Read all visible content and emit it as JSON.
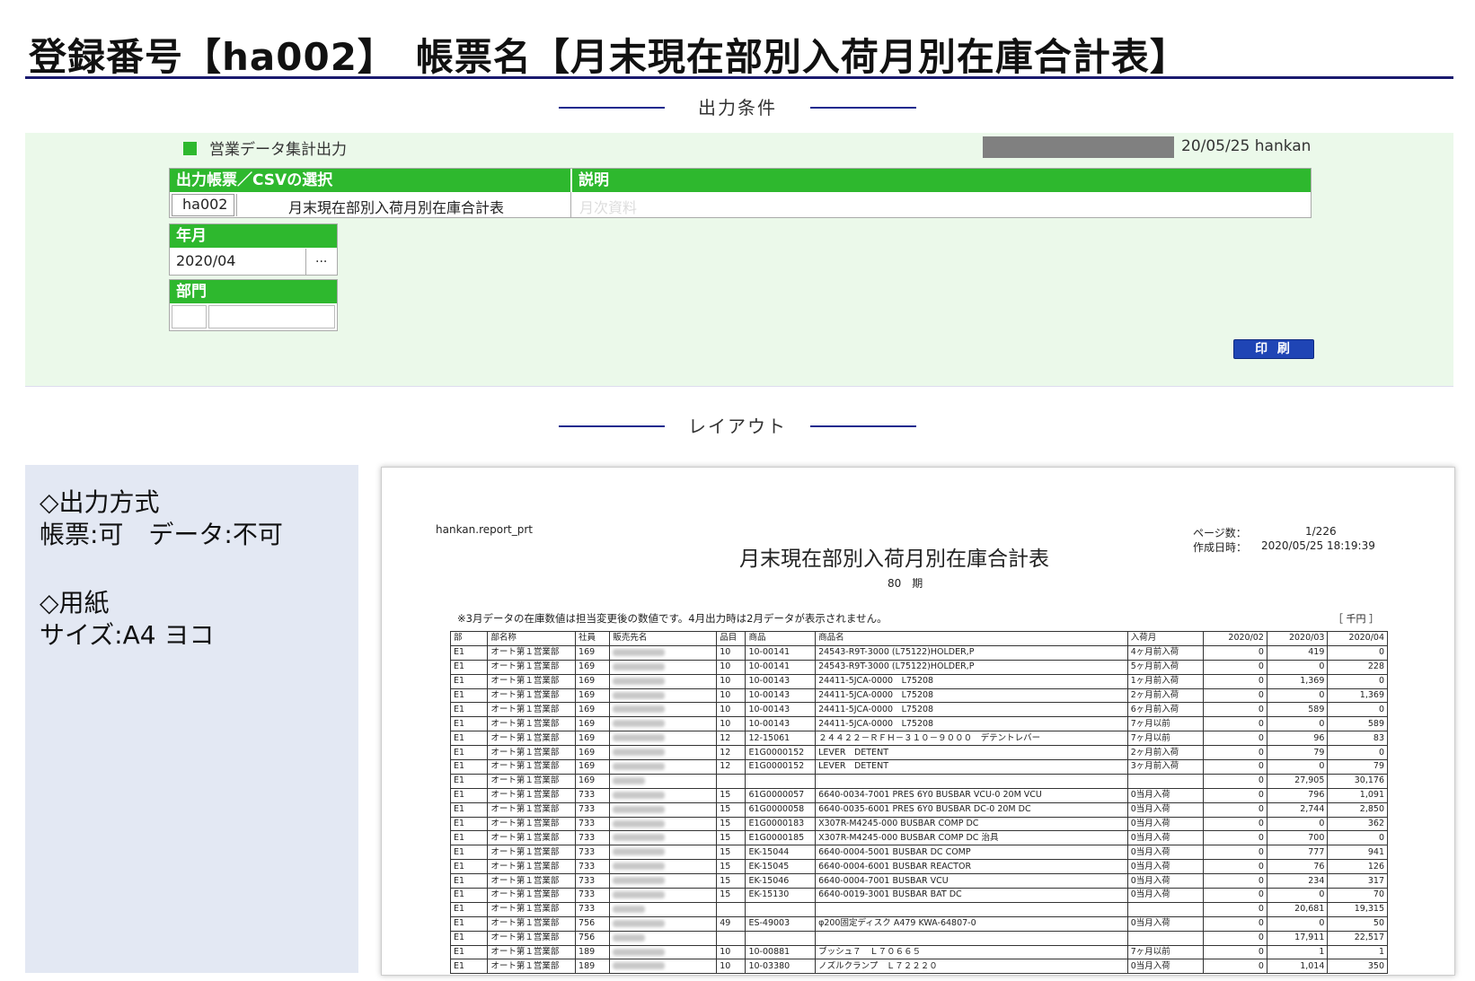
{
  "header": {
    "title": "登録番号【ha002】　帳票名【月末現在部別入荷月別在庫合計表】"
  },
  "sections": {
    "conditions": "出力条件",
    "layout": "レイアウト"
  },
  "condition_panel": {
    "menu_title": "営業データ集計出力",
    "user_info": "20/05/25 hankan",
    "report_select_header": "出力帳票／CSVの選択",
    "description_header": "説明",
    "report_code": "ha002",
    "report_name": "月末現在部別入荷月別在庫合計表",
    "description": "月次資料",
    "year_month_header": "年月",
    "year_month_value": "2020/04",
    "year_month_picker": "...",
    "department_header": "部門",
    "department_code": "",
    "department_name": "",
    "print_button": "印 刷"
  },
  "left_info": {
    "output_method_title": "◇出力方式",
    "output_method_value": "帳票:可　データ:不可",
    "paper_title": "◇用紙",
    "paper_value": "サイズ:A4 ヨコ"
  },
  "report_preview": {
    "program": "hankan.report_prt",
    "page_label": "ページ数：",
    "page_value": "1/226",
    "created_label": "作成日時：",
    "created_value": "2020/05/25 18:19:39",
    "title": "月末現在部別入荷月別在庫合計表",
    "period": "80　期",
    "note": "※3月データの在庫数値は担当変更後の数値です。4月出力時は2月データが表示されません。",
    "unit": "［ 千円 ］",
    "columns": [
      "部",
      "部名称",
      "社員",
      "販売先名",
      "品目",
      "商品",
      "商品名",
      "入荷月",
      "2020/02",
      "2020/03",
      "2020/04"
    ],
    "rows": [
      [
        "E1",
        "オート第１営業部",
        "169",
        "",
        "10",
        "10-00141",
        "24543-R9T-3000 (L75122)HOLDER,P",
        "4ヶ月前入荷",
        "0",
        "419",
        "0"
      ],
      [
        "E1",
        "オート第１営業部",
        "169",
        "",
        "10",
        "10-00141",
        "24543-R9T-3000 (L75122)HOLDER,P",
        "5ヶ月前入荷",
        "0",
        "0",
        "228"
      ],
      [
        "E1",
        "オート第１営業部",
        "169",
        "",
        "10",
        "10-00143",
        "24411-5JCA-0000　L75208",
        "1ヶ月前入荷",
        "0",
        "1,369",
        "0"
      ],
      [
        "E1",
        "オート第１営業部",
        "169",
        "",
        "10",
        "10-00143",
        "24411-5JCA-0000　L75208",
        "2ヶ月前入荷",
        "0",
        "0",
        "1,369"
      ],
      [
        "E1",
        "オート第１営業部",
        "169",
        "",
        "10",
        "10-00143",
        "24411-5JCA-0000　L75208",
        "6ヶ月前入荷",
        "0",
        "589",
        "0"
      ],
      [
        "E1",
        "オート第１営業部",
        "169",
        "",
        "10",
        "10-00143",
        "24411-5JCA-0000　L75208",
        "7ヶ月以前",
        "0",
        "0",
        "589"
      ],
      [
        "E1",
        "オート第１営業部",
        "169",
        "",
        "12",
        "12-15061",
        "２４４２２－ＲＦＨ－３１０－９０００　デテントレバー",
        "7ヶ月以前",
        "0",
        "96",
        "83"
      ],
      [
        "E1",
        "オート第１営業部",
        "169",
        "",
        "12",
        "E1G0000152",
        "LEVER　DETENT",
        "2ヶ月前入荷",
        "0",
        "79",
        "0"
      ],
      [
        "E1",
        "オート第１営業部",
        "169",
        "",
        "12",
        "E1G0000152",
        "LEVER　DETENT",
        "3ヶ月前入荷",
        "0",
        "0",
        "79"
      ],
      [
        "E1",
        "オート第１営業部",
        "169",
        "",
        "",
        "",
        "",
        "",
        "0",
        "27,905",
        "30,176"
      ],
      [
        "E1",
        "オート第１営業部",
        "733",
        "",
        "15",
        "61G0000057",
        "6640-0034-7001 PRES 6Y0 BUSBAR VCU-0 20M VCU",
        "0当月入荷",
        "0",
        "796",
        "1,091"
      ],
      [
        "E1",
        "オート第１営業部",
        "733",
        "",
        "15",
        "61G0000058",
        "6640-0035-6001 PRES 6Y0 BUSBAR DC-0 20M DC",
        "0当月入荷",
        "0",
        "2,744",
        "2,850"
      ],
      [
        "E1",
        "オート第１営業部",
        "733",
        "",
        "15",
        "E1G0000183",
        "X307R-M4245-000 BUSBAR COMP DC",
        "0当月入荷",
        "0",
        "0",
        "362"
      ],
      [
        "E1",
        "オート第１営業部",
        "733",
        "",
        "15",
        "E1G0000185",
        "X307R-M4245-000 BUSBAR COMP DC 治具",
        "0当月入荷",
        "0",
        "700",
        "0"
      ],
      [
        "E1",
        "オート第１営業部",
        "733",
        "",
        "15",
        "EK-15044",
        "6640-0004-5001 BUSBAR DC COMP",
        "0当月入荷",
        "0",
        "777",
        "941"
      ],
      [
        "E1",
        "オート第１営業部",
        "733",
        "",
        "15",
        "EK-15045",
        "6640-0004-6001 BUSBAR REACTOR",
        "0当月入荷",
        "0",
        "76",
        "126"
      ],
      [
        "E1",
        "オート第１営業部",
        "733",
        "",
        "15",
        "EK-15046",
        "6640-0004-7001 BUSBAR VCU",
        "0当月入荷",
        "0",
        "234",
        "317"
      ],
      [
        "E1",
        "オート第１営業部",
        "733",
        "",
        "15",
        "EK-15130",
        "6640-0019-3001 BUSBAR BAT DC",
        "0当月入荷",
        "0",
        "0",
        "70"
      ],
      [
        "E1",
        "オート第１営業部",
        "733",
        "",
        "",
        "",
        "",
        "",
        "0",
        "20,681",
        "19,315"
      ],
      [
        "E1",
        "オート第１営業部",
        "756",
        "",
        "49",
        "ES-49003",
        "φ200固定ディスク A479 KWA-64807-0",
        "0当月入荷",
        "0",
        "0",
        "50"
      ],
      [
        "E1",
        "オート第１営業部",
        "756",
        "",
        "",
        "",
        "",
        "",
        "0",
        "17,911",
        "22,517"
      ],
      [
        "E1",
        "オート第１営業部",
        "189",
        "",
        "10",
        "10-00881",
        "ブッシュ７　Ｌ７０６６５",
        "7ヶ月以前",
        "0",
        "1",
        "1"
      ],
      [
        "E1",
        "オート第１営業部",
        "189",
        "",
        "10",
        "10-03380",
        "ノズルクランプ　Ｌ７２２２０",
        "0当月入荷",
        "0",
        "1,014",
        "350"
      ]
    ]
  }
}
